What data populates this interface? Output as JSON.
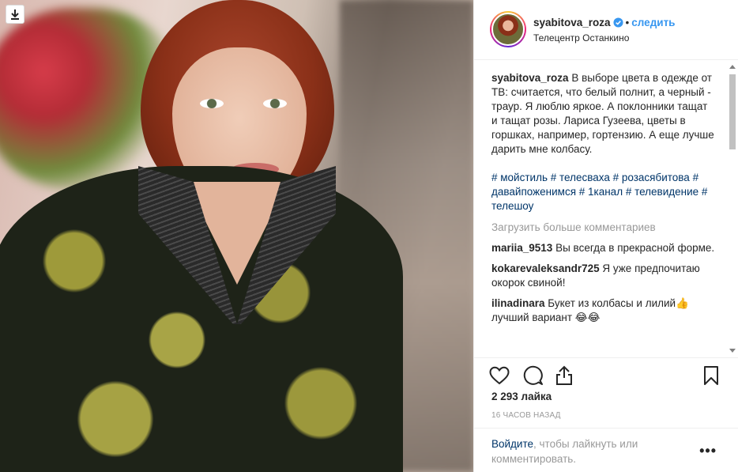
{
  "post": {
    "username": "syabitova_roza",
    "verified_icon": "verified-badge-icon",
    "separator": "•",
    "follow_label": "следить",
    "location": "Телецентр Останкино"
  },
  "caption": {
    "username": "syabitova_roza",
    "text": "В выборе цвета в одежде от ТВ: считается, что белый полнит, а черный - траур. Я люблю яркое. А поклонники тащат и тащат розы. Лариса Гузеева, цветы в горшках, например, гортензию. А еще лучше дарить мне колбасу.",
    "hashtags": "# мойстиль # телесваха # розасябитова # давайпоженимся # 1канал # телевидение # телешоу"
  },
  "load_more_label": "Загрузить больше комментариев",
  "comments": [
    {
      "username": "mariia_9513",
      "text": "Вы всегда в прекрасной форме."
    },
    {
      "username": "kokarevaleksandr725",
      "text": "Я уже предпочитаю окорок свиной!"
    },
    {
      "username": "ilinadinara",
      "text": "Букет из колбасы и лилий👍 лучший вариант 😂😂"
    }
  ],
  "likes": "2 293 лайка",
  "time_ago": "16 ЧАСОВ НАЗАД",
  "login_prompt": {
    "link": "Войдите",
    "rest": ", чтобы лайкнуть или комментировать."
  },
  "more_options": "•••",
  "colors": {
    "link_blue": "#3897f0",
    "hashtag_navy": "#003569",
    "muted_gray": "#999999",
    "text_dark": "#262626"
  }
}
